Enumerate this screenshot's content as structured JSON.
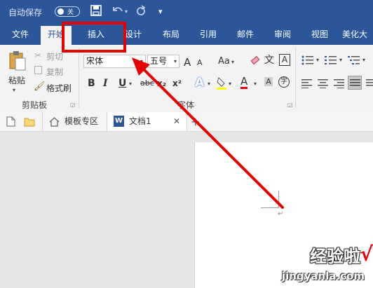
{
  "titlebar": {
    "autosave_label": "自动保存",
    "autosave_state": "关",
    "save_icon": "save-icon",
    "undo_icon": "undo-icon",
    "redo_icon": "redo-icon",
    "more_icon": "customize-qat-icon",
    "bg_color": "#2b579a"
  },
  "tabs": [
    "文件",
    "开始",
    "插入",
    "设计",
    "布局",
    "引用",
    "邮件",
    "审阅",
    "视图",
    "美化大"
  ],
  "active_tab": "开始",
  "ribbon": {
    "clipboard": {
      "paste": "粘贴",
      "cut": "剪切",
      "copy": "复制",
      "format_painter": "格式刷",
      "group": "剪贴板"
    },
    "font": {
      "font_name": "宋体",
      "font_size": "五号",
      "big_a": "A",
      "small_a": "A",
      "aa": "Aa",
      "wen": "文",
      "bold": "B",
      "italic": "I",
      "underline": "U",
      "strike": "abc",
      "sub": "x₂",
      "sup": "x²",
      "effects": "A",
      "font_color": "A",
      "char_circle": "字",
      "group": "字体"
    }
  },
  "doc_tabs": {
    "template_zone": "模板专区",
    "document": "文档1",
    "close": "✕",
    "add": "+"
  },
  "watermark": {
    "line1": "经验啦",
    "line2": "jingyanla.com",
    "check": "√"
  },
  "colors": {
    "accent": "#2b579a",
    "annotation": "#e60000"
  }
}
